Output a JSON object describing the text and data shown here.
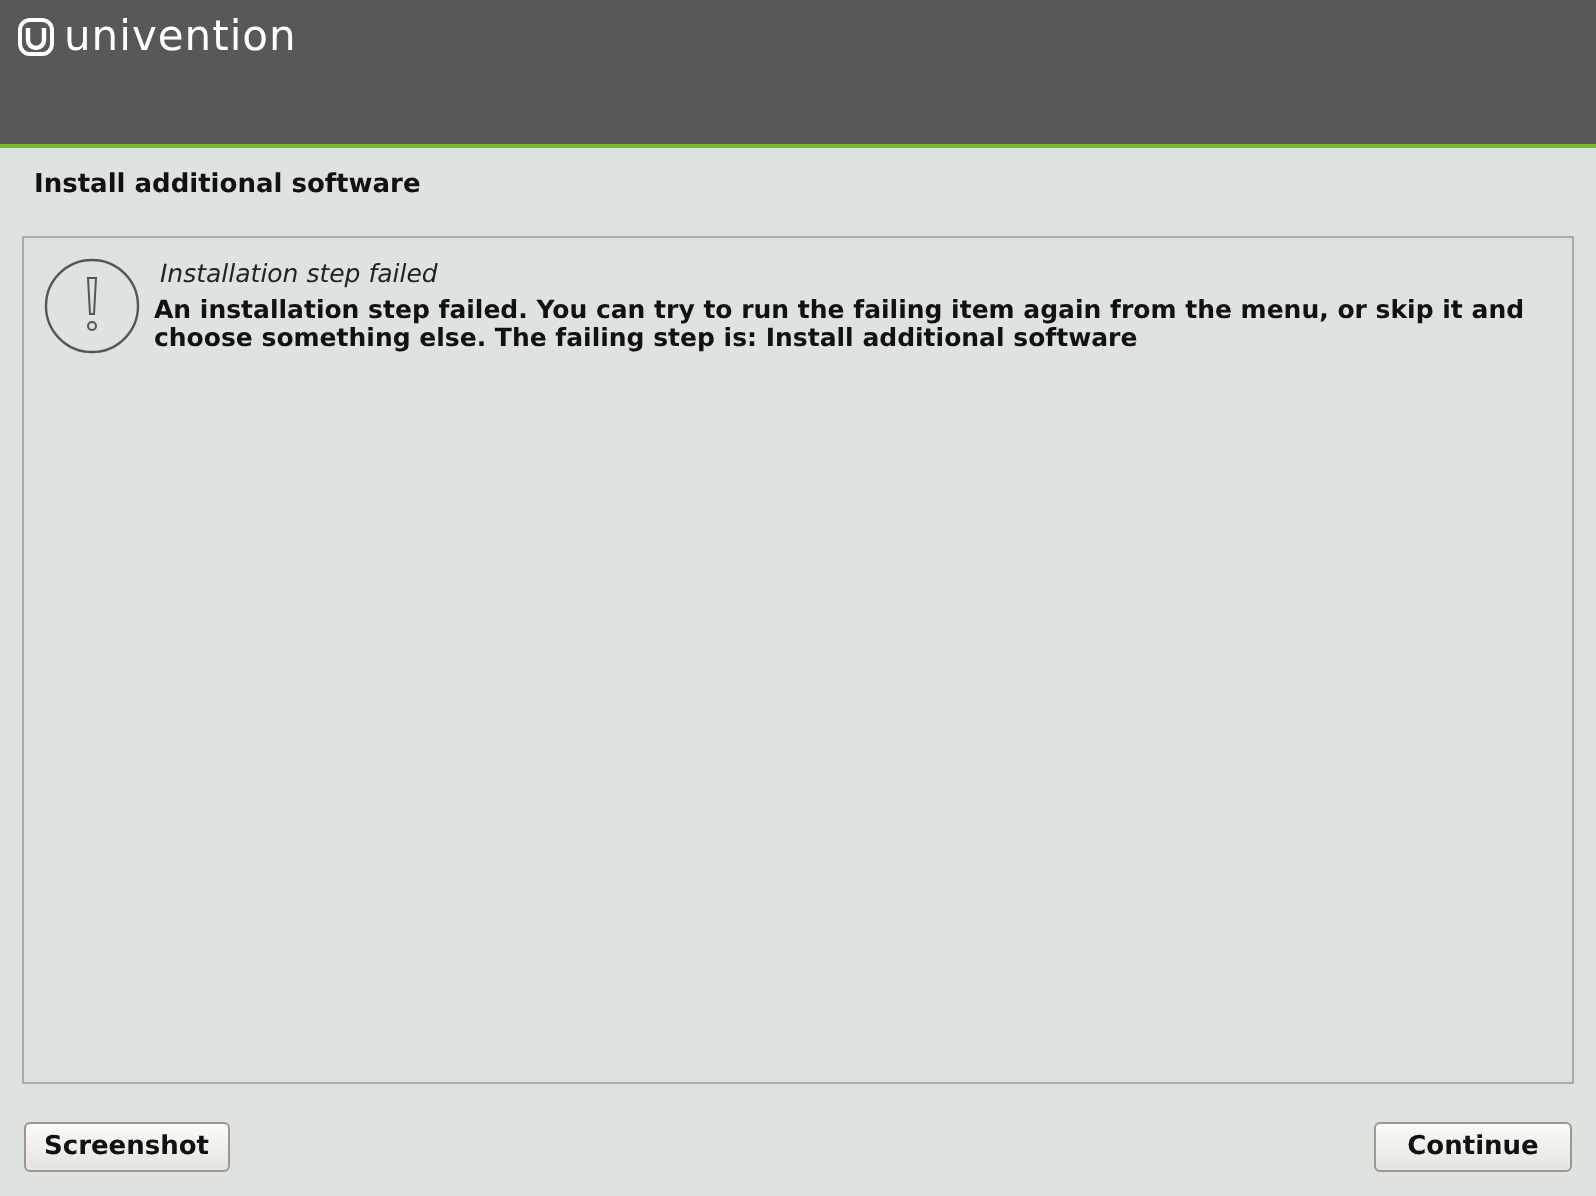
{
  "header": {
    "logo_text": "univention"
  },
  "page": {
    "title": "Install additional software"
  },
  "message": {
    "title": "Installation step failed",
    "body": "An installation step failed. You can try to run the failing item again from the menu, or skip it and choose something else. The failing step is: Install additional software"
  },
  "buttons": [
    {
      "label": "Screenshot",
      "kind": "left"
    },
    {
      "label": "Continue",
      "kind": "right"
    }
  ]
}
